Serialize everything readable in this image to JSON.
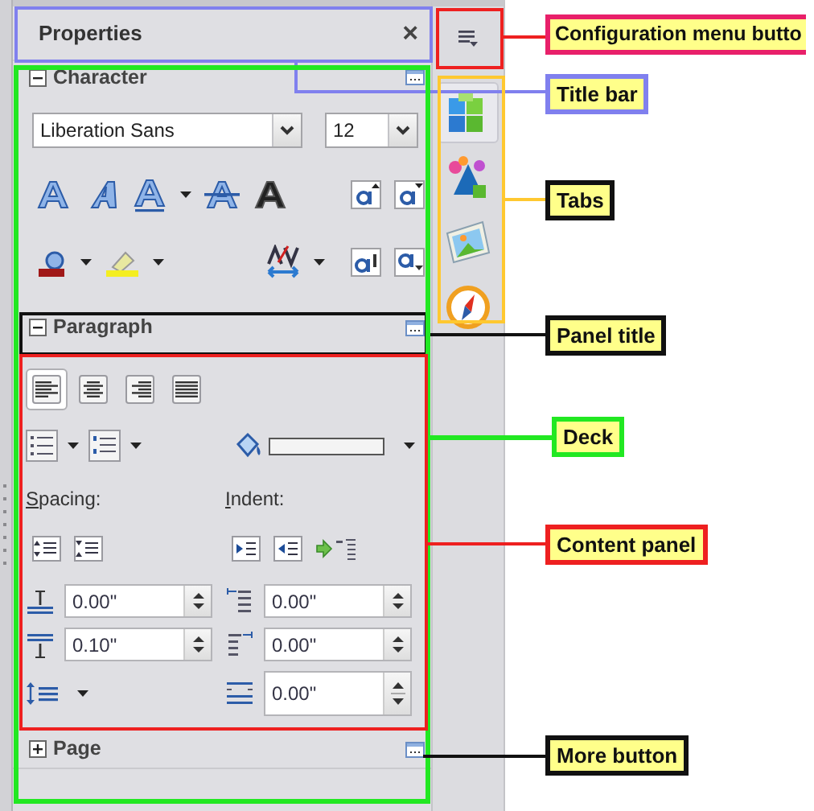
{
  "title_bar": {
    "title": "Properties",
    "close_symbol": "×"
  },
  "character": {
    "title": "Character",
    "expanded": true,
    "font_name": "Liberation Sans",
    "font_size": "12"
  },
  "paragraph": {
    "title": "Paragraph",
    "expanded": true,
    "alignment": [
      {
        "selected": true
      },
      {
        "selected": false
      },
      {
        "selected": false
      },
      {
        "selected": false
      }
    ],
    "spacing_label": "Spacing:",
    "indent_label": "Indent:",
    "above_spacing": "0.00\"",
    "before_indent": "0.00\"",
    "below_spacing": "0.10\"",
    "after_indent": "0.00\"",
    "first_line_indent": "0.00\""
  },
  "page": {
    "title": "Page",
    "expanded": false
  },
  "tabs": [
    {
      "selected": true
    },
    {
      "selected": false
    },
    {
      "selected": false
    },
    {
      "selected": false
    }
  ],
  "annotations": [
    {
      "text": "Configuration menu butto",
      "color": "#e8206a",
      "leader": {
        "color": "#ee2020"
      }
    },
    {
      "text": "Title bar",
      "color": "#8080ee",
      "leader": {
        "color": "#8080ee"
      }
    },
    {
      "text": "Tabs",
      "color": "#111111",
      "leader": {
        "color": "#ffc830"
      }
    },
    {
      "text": "Panel title",
      "color": "#111111",
      "leader": {
        "color": "#111111"
      }
    },
    {
      "text": "Deck",
      "color": "#22e822",
      "leader": {
        "color": "#22e822"
      }
    },
    {
      "text": "Content panel",
      "color": "#ee2020",
      "leader": {
        "color": "#ee2020"
      }
    },
    {
      "text": "More button",
      "color": "#111111",
      "leader": {
        "color": "#111111"
      }
    }
  ]
}
